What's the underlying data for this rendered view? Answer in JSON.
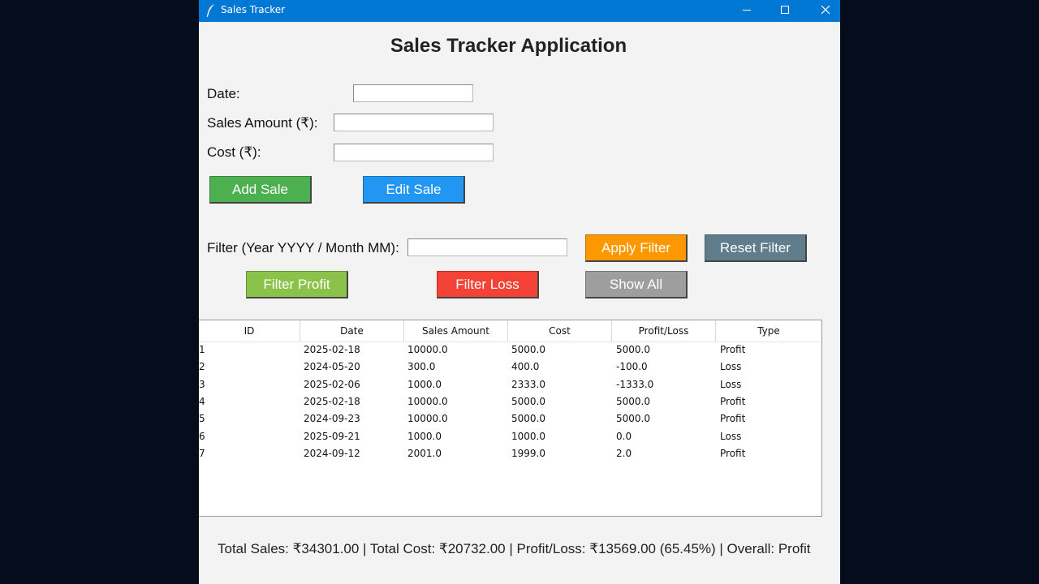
{
  "window": {
    "title": "Sales Tracker",
    "heading": "Sales Tracker Application"
  },
  "form": {
    "date_label": "Date:",
    "date_value": "",
    "sales_label": "Sales Amount (₹):",
    "sales_value": "",
    "cost_label": "Cost (₹):",
    "cost_value": "",
    "add_label": "Add Sale",
    "edit_label": "Edit Sale"
  },
  "filter": {
    "label": "Filter (Year YYYY / Month MM):",
    "value": "",
    "apply_label": "Apply Filter",
    "reset_label": "Reset Filter",
    "profit_label": "Filter Profit",
    "loss_label": "Filter Loss",
    "show_all_label": "Show All"
  },
  "table": {
    "columns": [
      "ID",
      "Date",
      "Sales Amount",
      "Cost",
      "Profit/Loss",
      "Type"
    ],
    "rows": [
      [
        "1",
        "2025-02-18",
        "10000.0",
        "5000.0",
        "5000.0",
        "Profit"
      ],
      [
        "2",
        "2024-05-20",
        "300.0",
        "400.0",
        "-100.0",
        "Loss"
      ],
      [
        "3",
        "2025-02-06",
        "1000.0",
        "2333.0",
        "-1333.0",
        "Loss"
      ],
      [
        "4",
        "2025-02-18",
        "10000.0",
        "5000.0",
        "5000.0",
        "Profit"
      ],
      [
        "5",
        "2024-09-23",
        "10000.0",
        "5000.0",
        "5000.0",
        "Profit"
      ],
      [
        "6",
        "2025-09-21",
        "1000.0",
        "1000.0",
        "0.0",
        "Loss"
      ],
      [
        "7",
        "2024-09-12",
        "2001.0",
        "1999.0",
        "2.0",
        "Profit"
      ]
    ]
  },
  "summary": "Total Sales: ₹34301.00 | Total Cost: ₹20732.00 | Profit/Loss: ₹13569.00 (65.45%) | Overall: Profit",
  "icons": {
    "app": "feather-icon",
    "minimize": "minimize-icon",
    "maximize": "maximize-icon",
    "close": "close-icon"
  },
  "colors": {
    "titlebar": "#0078d4",
    "add": "#4caf50",
    "edit": "#2196f3",
    "apply": "#ff9800",
    "reset": "#607d8b",
    "profit": "#8bc34a",
    "loss": "#f44336",
    "show_all": "#9e9e9e"
  }
}
